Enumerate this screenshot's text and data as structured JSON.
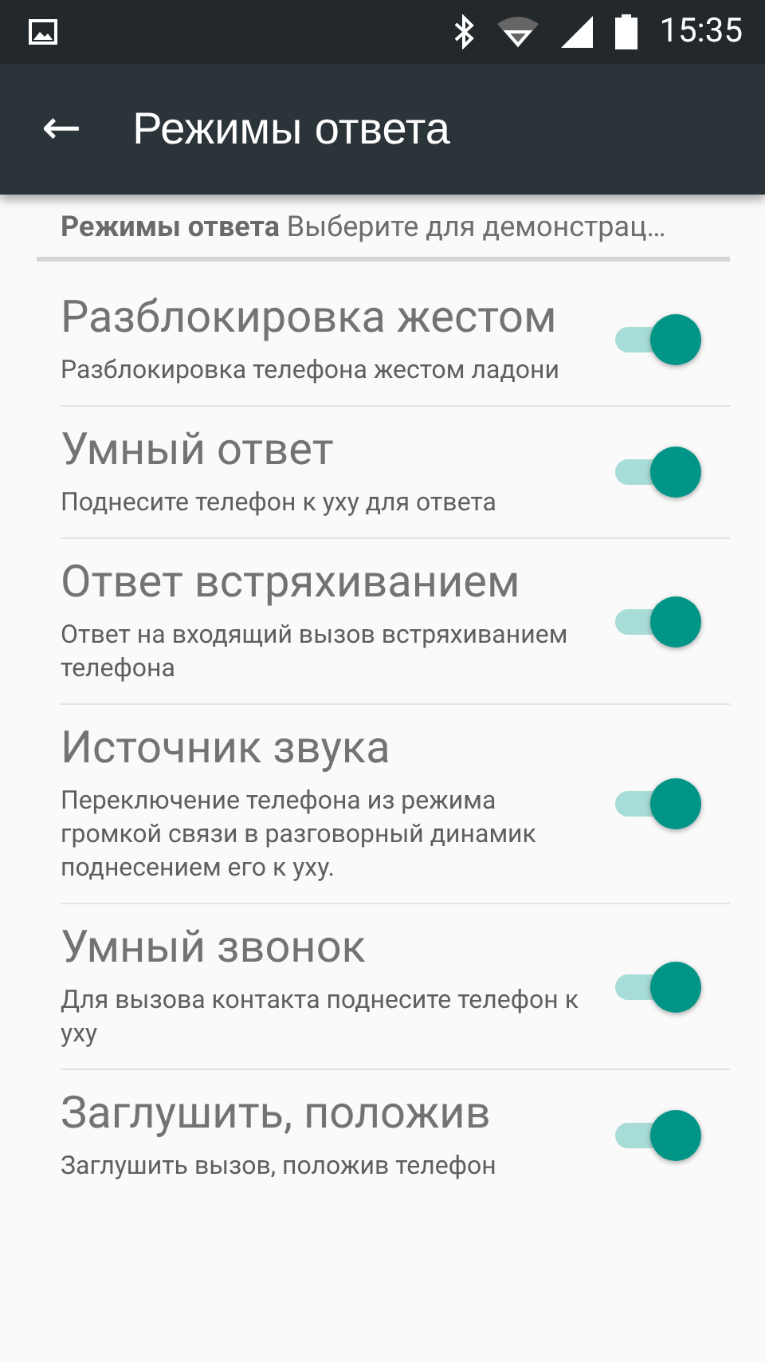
{
  "status_bar": {
    "time": "15:35"
  },
  "toolbar": {
    "back": "←",
    "title": "Режимы ответа"
  },
  "header": {
    "text": "**Режимы ответа** Выберите для демонстрац…"
  },
  "settings": [
    {
      "title": "Разблокировка жестом",
      "summary": "Разблокировка телефона жестом ладони",
      "on": true
    },
    {
      "title": "Умный ответ",
      "summary": "Поднесите телефон к уху для ответа",
      "on": true
    },
    {
      "title": "Ответ встряхиванием",
      "summary": "Ответ на входящий вызов встряхиванием телефона",
      "on": true
    },
    {
      "title": "Источник звука",
      "summary": "Переключение телефона из режима громкой связи в разговорный динамик поднесением его к уху.",
      "on": true
    },
    {
      "title": "Умный звонок",
      "summary": "Для вызова контакта поднесите телефон к уху",
      "on": true
    },
    {
      "title": "Заглушить, положив",
      "summary": "Заглушить вызов, положив телефон",
      "on": true
    }
  ]
}
